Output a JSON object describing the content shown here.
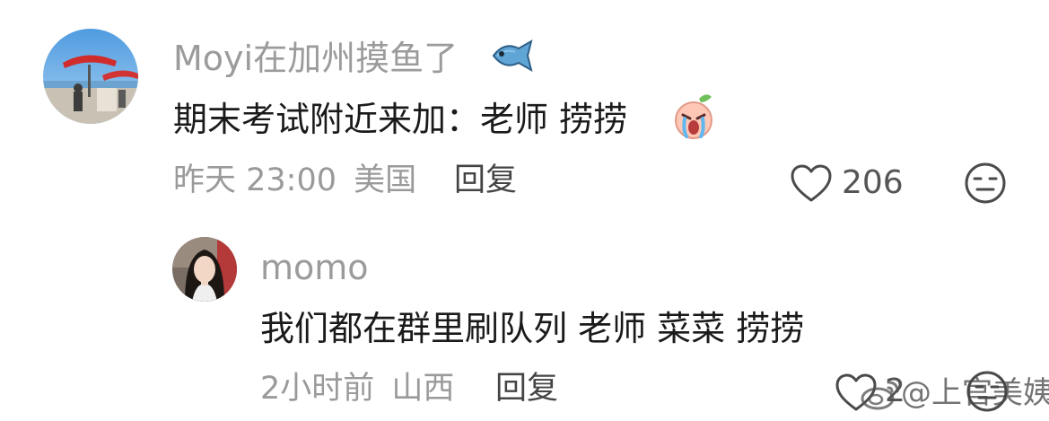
{
  "comments": [
    {
      "username": "Moyi在加州摸鱼了",
      "username_emoji": "fish-emoji",
      "text": "期末考试附近来加：老师 捞捞",
      "text_emoji": "crying-peach-emoji",
      "time": "昨天 23:00",
      "location": "美国",
      "reply_label": "回复",
      "like_count": "206"
    },
    {
      "username": "momo",
      "text": "我们都在群里刷队列 老师 菜菜 捞捞",
      "time": "2小时前",
      "location": "山西",
      "reply_label": "回复",
      "like_count": "2"
    }
  ],
  "watermark": {
    "text": "@上官美姨",
    "icon": "weibo-logo-icon"
  },
  "icons": {
    "like": "heart-outline-icon",
    "dislike": "meh-face-icon"
  },
  "colors": {
    "username": "#9b9b9b",
    "text": "#1a1a1a",
    "meta": "#9a9a9a",
    "reply": "#444444"
  }
}
